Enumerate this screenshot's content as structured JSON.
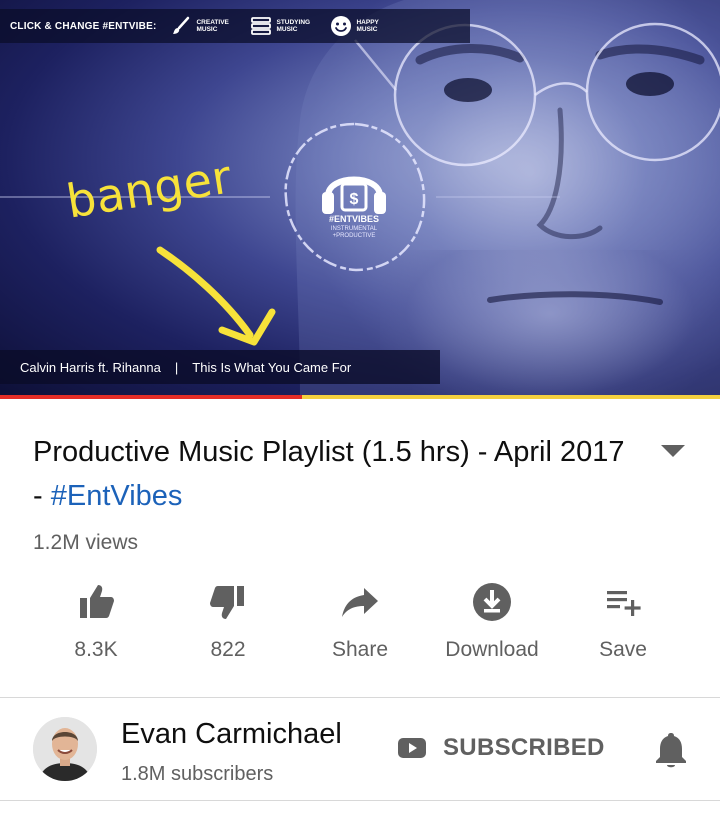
{
  "thumbnail": {
    "cta": "CLICK & CHANGE #ENTVIBE:",
    "moods": [
      {
        "icon": "paintbrush-icon",
        "label": "CREATIVE\nMUSIC"
      },
      {
        "icon": "books-icon",
        "label": "STUDYING\nMUSIC"
      },
      {
        "icon": "smiley-icon",
        "label": "HAPPY\nMUSIC"
      }
    ],
    "logo_brand": "#ENTVIBES",
    "logo_sub": "INSTRUMENTAL\n+PRODUCTIVE",
    "annotation": "banger",
    "annotation_color": "#f7e23a",
    "song_artist": "Calvin Harris ft. Rihanna",
    "song_separator": "|",
    "song_title": "This Is What You Came For",
    "progress_played_fraction": 0.42
  },
  "video": {
    "title_main": "Productive Music Playlist (1.5 hrs) - April 2017 - ",
    "title_hashtag": "#EntVibes",
    "views": "1.2M views"
  },
  "actions": [
    {
      "name": "like",
      "icon": "thumbs-up-icon",
      "label": "8.3K"
    },
    {
      "name": "dislike",
      "icon": "thumbs-down-icon",
      "label": "822"
    },
    {
      "name": "share",
      "icon": "share-arrow-icon",
      "label": "Share"
    },
    {
      "name": "download",
      "icon": "download-icon",
      "label": "Download"
    },
    {
      "name": "save",
      "icon": "playlist-add-icon",
      "label": "Save"
    }
  ],
  "channel": {
    "name": "Evan Carmichael",
    "subscribers": "1.8M subscribers",
    "subscribe_label": "SUBSCRIBED"
  },
  "colors": {
    "hashtag": "#1c62b9",
    "secondary_text": "#606060",
    "progress_played": "#e52d27",
    "progress_buffer": "#f4d03f"
  }
}
